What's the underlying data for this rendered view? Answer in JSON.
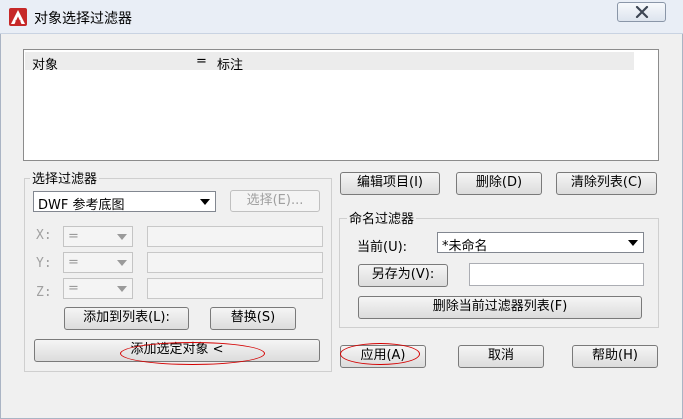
{
  "window": {
    "title": "对象选择过滤器",
    "icon": "autocad-logo-icon",
    "accent_red": "#d32f2f"
  },
  "filter_list": {
    "rows": [
      {
        "object": "对象",
        "operator": "=",
        "value": "标注"
      }
    ]
  },
  "select_filter": {
    "legend": "选择过滤器",
    "type_value": "DWF 参考底图",
    "select_button": "选择(E)...",
    "x_label": "X:",
    "y_label": "Y:",
    "z_label": "Z:",
    "x_operator": "=",
    "y_operator": "=",
    "z_operator": "=",
    "add_to_list_button": "添加到列表(L):",
    "replace_button": "替换(S)",
    "add_selected_object_button": "添加选定对象 <"
  },
  "list_actions": {
    "edit_item_button": "编辑项目(I)",
    "delete_button": "删除(D)",
    "clear_list_button": "清除列表(C)"
  },
  "named_filters": {
    "legend": "命名过滤器",
    "current_label": "当前(U):",
    "current_value": "*未命名",
    "save_as_button": "另存为(V):",
    "save_as_value": "",
    "delete_current_button": "删除当前过滤器列表(F)"
  },
  "footer": {
    "apply_button": "应用(A)",
    "cancel_button": "取消",
    "help_button": "帮助(H)"
  },
  "annotation": {
    "ellipse_color": "#d40000"
  }
}
